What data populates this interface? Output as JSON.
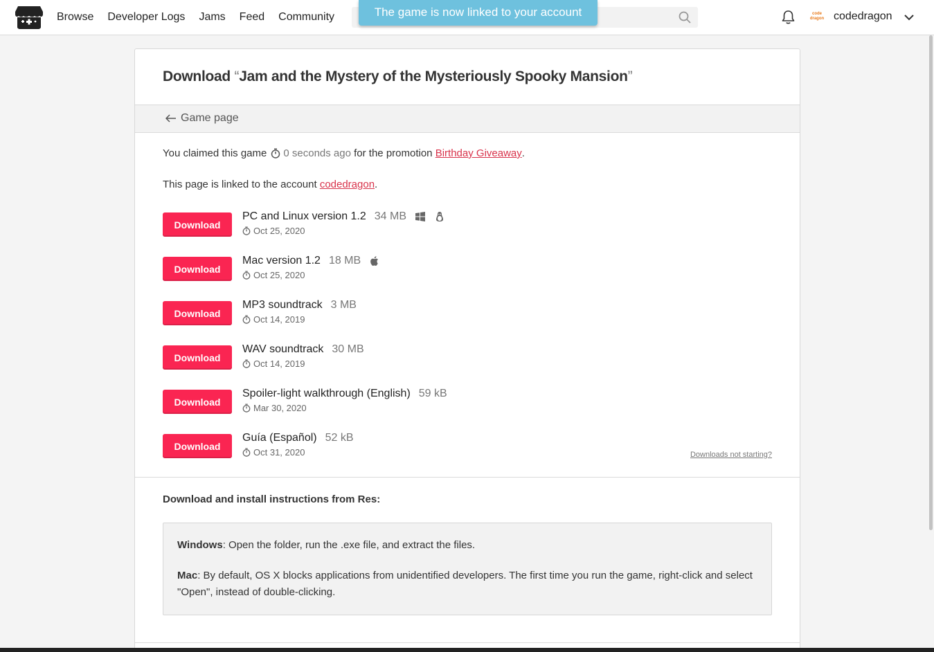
{
  "header": {
    "nav": [
      "Browse",
      "Developer Logs",
      "Jams",
      "Feed",
      "Community"
    ],
    "search_placeholder": "",
    "toast": "The game is now linked to your account",
    "username": "codedragon",
    "avatar_text_1": "code",
    "avatar_text_2": "dragon"
  },
  "page": {
    "title_prefix": "Download",
    "title_open_quote": "“",
    "title_game": "Jam and the Mystery of the Mysteriously Spooky Mansion",
    "title_close_quote": "”",
    "back_label": "Game page",
    "claim_text": "You claimed this game",
    "claim_time": "0 seconds ago",
    "claim_for": "for the promotion",
    "promotion": "Birthday Giveaway",
    "claim_end": ".",
    "linked_text": "This page is linked to the account",
    "linked_account": "codedragon",
    "linked_end": ".",
    "download_label": "Download",
    "not_starting": "Downloads not starting?",
    "instructions_heading": "Download and install instructions from Res:",
    "windows_label": "Windows",
    "windows_text": ": Open the folder, run the .exe file, and extract the files.",
    "mac_label": "Mac",
    "mac_text": ": By default, OS X blocks applications from unidentified developers. The first time you run the game, right-click and select \"Open\", instead of double-clicking."
  },
  "uploads": [
    {
      "name": "PC and Linux version 1.2",
      "size": "34 MB",
      "date": "Oct 25, 2020",
      "platforms": [
        "windows-icon",
        "linux-icon"
      ]
    },
    {
      "name": "Mac version 1.2",
      "size": "18 MB",
      "date": "Oct 25, 2020",
      "platforms": [
        "apple-icon"
      ]
    },
    {
      "name": "MP3 soundtrack",
      "size": "3 MB",
      "date": "Oct 14, 2019",
      "platforms": []
    },
    {
      "name": "WAV soundtrack",
      "size": "30 MB",
      "date": "Oct 14, 2019",
      "platforms": []
    },
    {
      "name": "Spoiler-light walkthrough (English)",
      "size": "59 kB",
      "date": "Mar 30, 2020",
      "platforms": []
    },
    {
      "name": "Guía (Español)",
      "size": "52 kB",
      "date": "Oct 31, 2020",
      "platforms": []
    }
  ],
  "colors": {
    "accent": "#fa2552",
    "link": "#d8324a",
    "toast": "#6ec1de"
  }
}
